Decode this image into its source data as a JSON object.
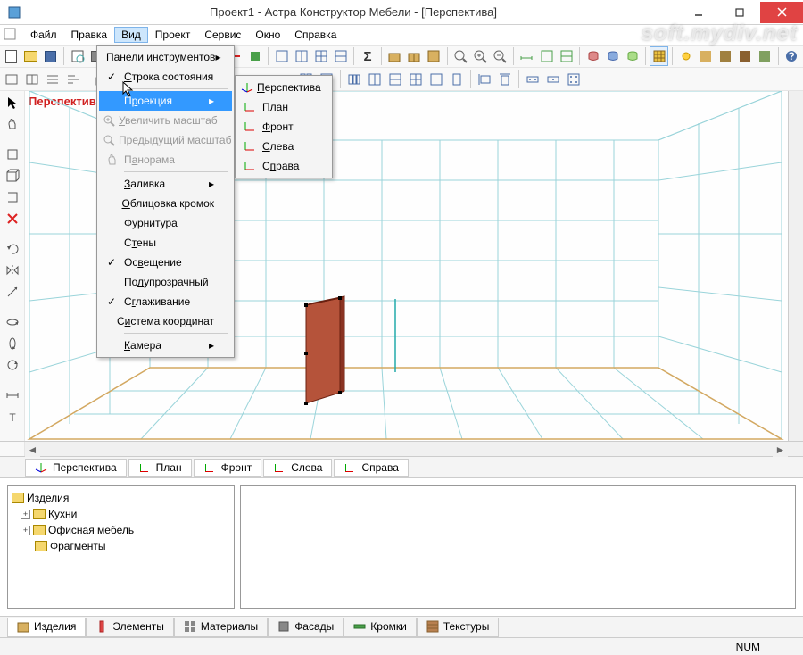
{
  "title": "Проект1 - Астра Конструктор Мебели - [Перспектива]",
  "watermark": "soft.mydiv.net",
  "menubar": {
    "file": "Файл",
    "edit": "Правка",
    "view": "Вид",
    "project": "Проект",
    "service": "Сервис",
    "window": "Окно",
    "help": "Справка"
  },
  "view_menu": {
    "toolbars": "Панели инструментов",
    "statusbar": "Строка состояния",
    "projection": "Проекция",
    "zoom_in": "Увеличить масштаб",
    "prev_zoom": "Предыдущий масштаб",
    "panorama": "Панорама",
    "fill": "Заливка",
    "edges": "Облицовка кромок",
    "hardware": "Фурнитура",
    "walls": "Стены",
    "lighting": "Освещение",
    "transparent": "Полупрозрачный",
    "smoothing": "Сглаживание",
    "coord_system": "Система координат",
    "camera": "Камера"
  },
  "proj_menu": {
    "perspective": "Перспектива",
    "plan": "План",
    "front": "Фронт",
    "left": "Слева",
    "right": "Справа"
  },
  "viewport_label": "Перспектива",
  "view_tabs": {
    "perspective": "Перспектива",
    "plan": "План",
    "front": "Фронт",
    "left": "Слева",
    "right": "Справа"
  },
  "tree": {
    "root": "Изделия",
    "n1": "Кухни",
    "n2": "Офисная мебель",
    "n3": "Фрагменты"
  },
  "bottom_tabs": {
    "products": "Изделия",
    "elements": "Элементы",
    "materials": "Материалы",
    "facades": "Фасады",
    "edges": "Кромки",
    "textures": "Текстуры"
  },
  "status": {
    "num": "NUM"
  }
}
